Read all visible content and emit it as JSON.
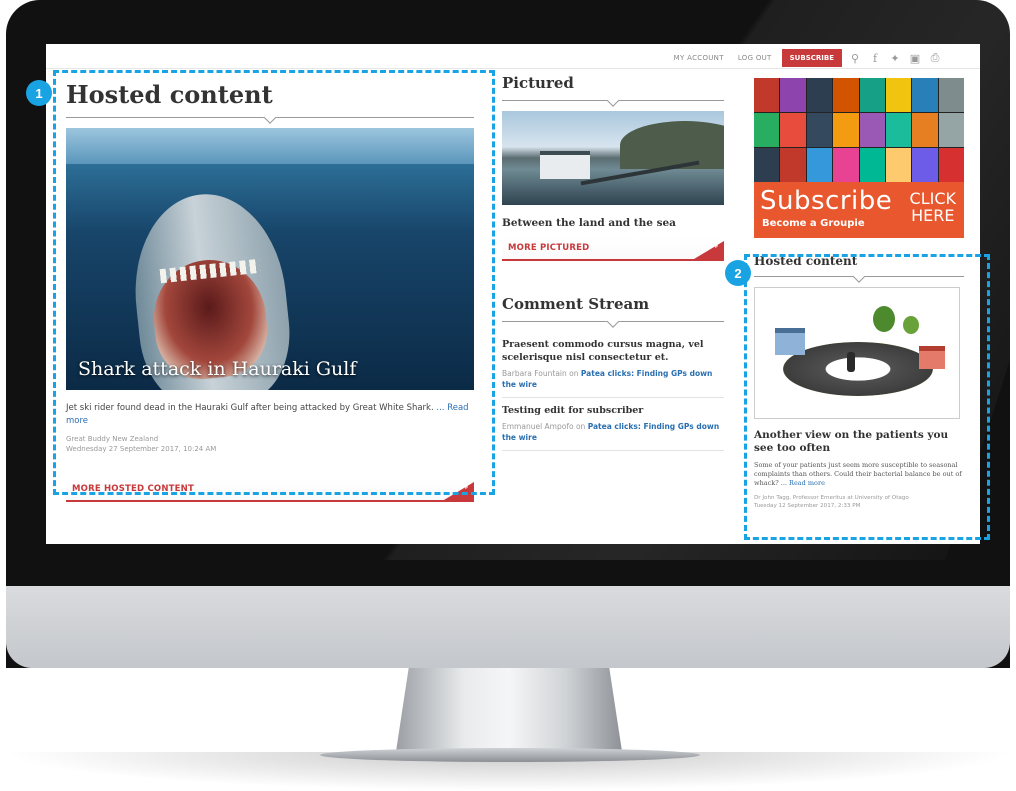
{
  "topbar": {
    "my_account": "MY ACCOUNT",
    "log_out": "LOG OUT",
    "subscribe": "SUBSCRIBE",
    "icons": [
      "search-icon",
      "facebook-icon",
      "twitter-icon",
      "instagram-icon",
      "print-icon"
    ]
  },
  "hosted_main": {
    "heading": "Hosted content",
    "image_caption": "Shark attack in Hauraki Gulf",
    "description": "Jet ski rider found dead in the Hauraki Gulf after being attacked by Great White Shark.",
    "read_more": "... Read more",
    "author": "Great Buddy New Zealand",
    "date": "Wednesday 27 September 2017, 10:24 AM",
    "more_button": "MORE HOSTED CONTENT"
  },
  "pictured": {
    "heading": "Pictured",
    "caption": "Between the land and the sea",
    "more_button": "MORE PICTURED"
  },
  "comment_stream": {
    "heading": "Comment Stream",
    "items": [
      {
        "title": "Praesent commodo cursus magna, vel scelerisque nisl consectetur et.",
        "author": "Barbara Fountain",
        "on": "on",
        "link": "Patea clicks: Finding GPs down the wire"
      },
      {
        "title": "Testing edit for subscriber",
        "author": "Emmanuel Ampofo",
        "on": "on",
        "link": "Patea clicks: Finding GPs down the wire"
      }
    ]
  },
  "subscribe_banner": {
    "title": "Subscribe",
    "subtitle": "Become a Groupie",
    "click": "CLICK",
    "here": "HERE",
    "cover_colors": [
      "#c0392b",
      "#8e44ad",
      "#2c3e50",
      "#d35400",
      "#16a085",
      "#f1c40f",
      "#2980b9",
      "#7f8c8d",
      "#27ae60",
      "#e74c3c",
      "#34495e",
      "#f39c12",
      "#9b59b6",
      "#1abc9c",
      "#e67e22",
      "#95a5a6",
      "#2c3e50",
      "#c0392b",
      "#3498db",
      "#e84393",
      "#00b894",
      "#fdcb6e",
      "#6c5ce7",
      "#d63031"
    ]
  },
  "hosted_side": {
    "heading": "Hosted content",
    "title": "Another view on the patients you see too often",
    "description": "Some of your patients just seem more susceptible to seasonal complaints than others. Could their bacterial balance be out of whack?",
    "read_more": "... Read more",
    "meta": "Dr John Tagg, Professor Emeritus at University of Otago",
    "date": "Tuesday 12 September 2017, 2:33 PM"
  },
  "callouts": {
    "badge1": "1",
    "badge2": "2",
    "color": "#1aa3e2"
  }
}
